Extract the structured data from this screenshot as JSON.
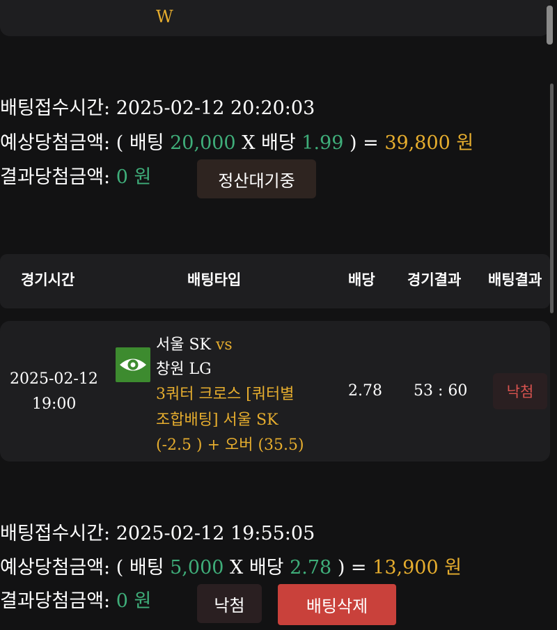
{
  "top_card": {
    "letter": "W"
  },
  "bet1": {
    "receipt_label": "배팅접수시간:",
    "receipt_time": "2025-02-12 20:20:03",
    "expected_label": "예상당첨금액:",
    "open_paren": "( 배팅",
    "stake": "20,000",
    "x_odds_label": "X 배당",
    "odds": "1.99",
    "equals": ") =",
    "payout": "39,800",
    "unit": "원",
    "result_label": "결과당첨금액:",
    "result_amount": "0",
    "result_unit": "원",
    "status": "정산대기중"
  },
  "table": {
    "headers": [
      "경기시간",
      "배팅타입",
      "배당",
      "경기결과",
      "배팅결과"
    ],
    "row": {
      "date": "2025-02-12",
      "time": "19:00",
      "team_home": "서울 SK",
      "vs": "vs",
      "team_away": "창원 LG",
      "bet_line1": "3쿼터 크로스 [쿼터별",
      "bet_line2": "조합배팅] 서울 SK",
      "bet_line3": "(-2.5 ) + 오버 (35.5)",
      "odds": "2.78",
      "score": "53 : 60",
      "result": "낙첨",
      "eye_icon": "eye-icon",
      "eye_color": "#3d8b2f"
    }
  },
  "bet2": {
    "receipt_label": "배팅접수시간:",
    "receipt_time": "2025-02-12 19:55:05",
    "expected_label": "예상당첨금액:",
    "open_paren": "( 배팅",
    "stake": "5,000",
    "x_odds_label": "X 배당",
    "odds": "2.78",
    "equals": ") =",
    "payout": "13,900",
    "unit": "원",
    "result_label": "결과당첨금액:",
    "result_amount": "0",
    "result_unit": "원",
    "status": "낙첨",
    "delete_label": "배팅삭제"
  },
  "colors": {
    "green": "#3fae7a",
    "gold": "#e6ad2e",
    "red": "#d9534f",
    "delete_button": "#c9413b"
  }
}
